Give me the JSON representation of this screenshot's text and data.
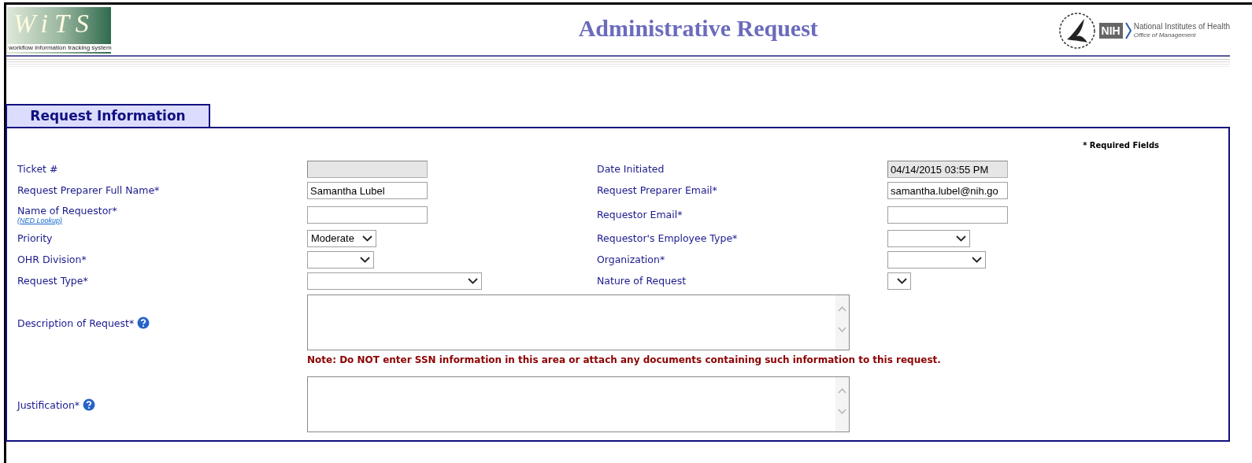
{
  "header": {
    "logo_text": "WiTS",
    "logo_caption": "workflow information tracking system",
    "title": "Administrative Request",
    "agency_badge": "NIH",
    "agency_name": "National Institutes of Health",
    "agency_office": "Office of Management"
  },
  "section_tab": {
    "label": "Request Information",
    "selected": true
  },
  "required_note": "* Required Fields",
  "rows": [
    {
      "left": {
        "label": "Ticket #",
        "kind": "readonly"
      },
      "right": {
        "label": "Date Initiated",
        "kind": "readonly",
        "value": "04/14/2015 03:55 PM"
      }
    },
    {
      "left": {
        "label": "Request Preparer Full Name*",
        "kind": "text",
        "value": "Samantha Lubel"
      },
      "right": {
        "label": "Request Preparer Email*",
        "kind": "text",
        "value": "samantha.lubel@nih.go"
      }
    },
    {
      "left": {
        "label": "Name of Requestor*",
        "link": "(NED Lookup)",
        "kind": "text"
      },
      "right": {
        "label": "Requestor Email*",
        "kind": "text"
      }
    },
    {
      "left": {
        "label": "Priority",
        "kind": "select",
        "value": "Moderate"
      },
      "right": {
        "label": "Requestor's Employee Type*",
        "kind": "select"
      }
    },
    {
      "left": {
        "label": "OHR Division*",
        "kind": "select"
      },
      "right": {
        "label": "Organization*",
        "kind": "select"
      }
    },
    {
      "left": {
        "label": "Request Type*",
        "kind": "select"
      },
      "right": {
        "label": "Nature of Request",
        "kind": "select"
      }
    }
  ],
  "text_areas": [
    {
      "label": "Description of Request*",
      "help": true,
      "note": "Note: Do NOT enter SSN information in this area or attach any documents containing such information to this request."
    },
    {
      "label": "Justification*",
      "help": true
    }
  ]
}
